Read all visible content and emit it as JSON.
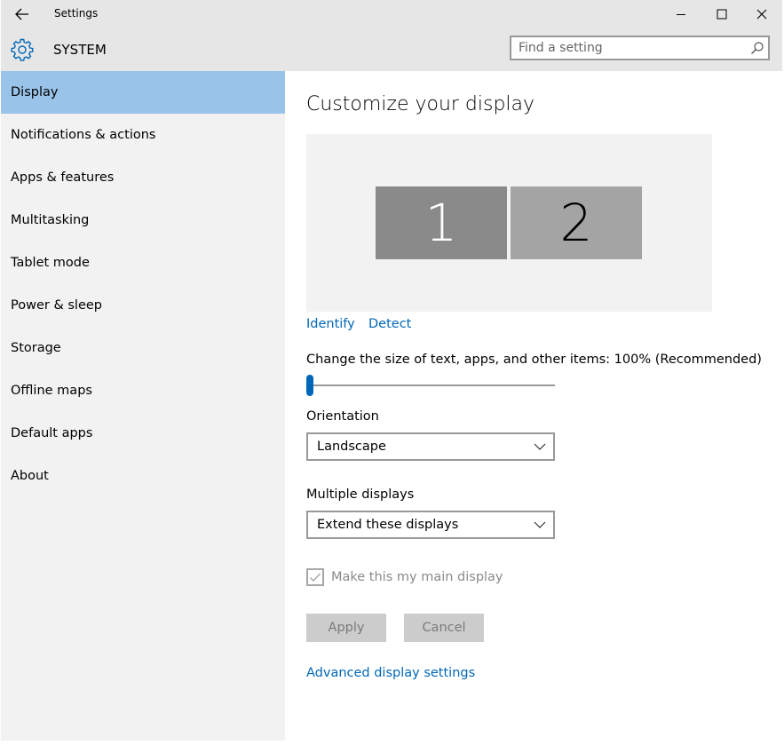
{
  "titlebar": {
    "title": "Settings"
  },
  "header": {
    "section_title": "SYSTEM",
    "search_placeholder": "Find a setting"
  },
  "sidebar": {
    "items": [
      {
        "label": "Display",
        "active": true
      },
      {
        "label": "Notifications & actions"
      },
      {
        "label": "Apps & features"
      },
      {
        "label": "Multitasking"
      },
      {
        "label": "Tablet mode"
      },
      {
        "label": "Power & sleep"
      },
      {
        "label": "Storage"
      },
      {
        "label": "Offline maps"
      },
      {
        "label": "Default apps"
      },
      {
        "label": "About"
      }
    ]
  },
  "main": {
    "heading": "Customize your display",
    "monitors": [
      "1",
      "2"
    ],
    "identify_link": "Identify",
    "detect_link": "Detect",
    "scale_label": "Change the size of text, apps, and other items: 100% (Recommended)",
    "scale_slider_percent": 0,
    "orientation_label": "Orientation",
    "orientation_value": "Landscape",
    "multiple_displays_label": "Multiple displays",
    "multiple_displays_value": "Extend these displays",
    "main_display_label": "Make this my main display",
    "main_display_checked": true,
    "apply_label": "Apply",
    "cancel_label": "Cancel",
    "advanced_link": "Advanced display settings"
  },
  "colors": {
    "accent": "#0067b8",
    "active_nav": "#99c3e8",
    "sidebar_bg": "#f2f2f2",
    "titlebar_bg": "#e6e6e6"
  }
}
